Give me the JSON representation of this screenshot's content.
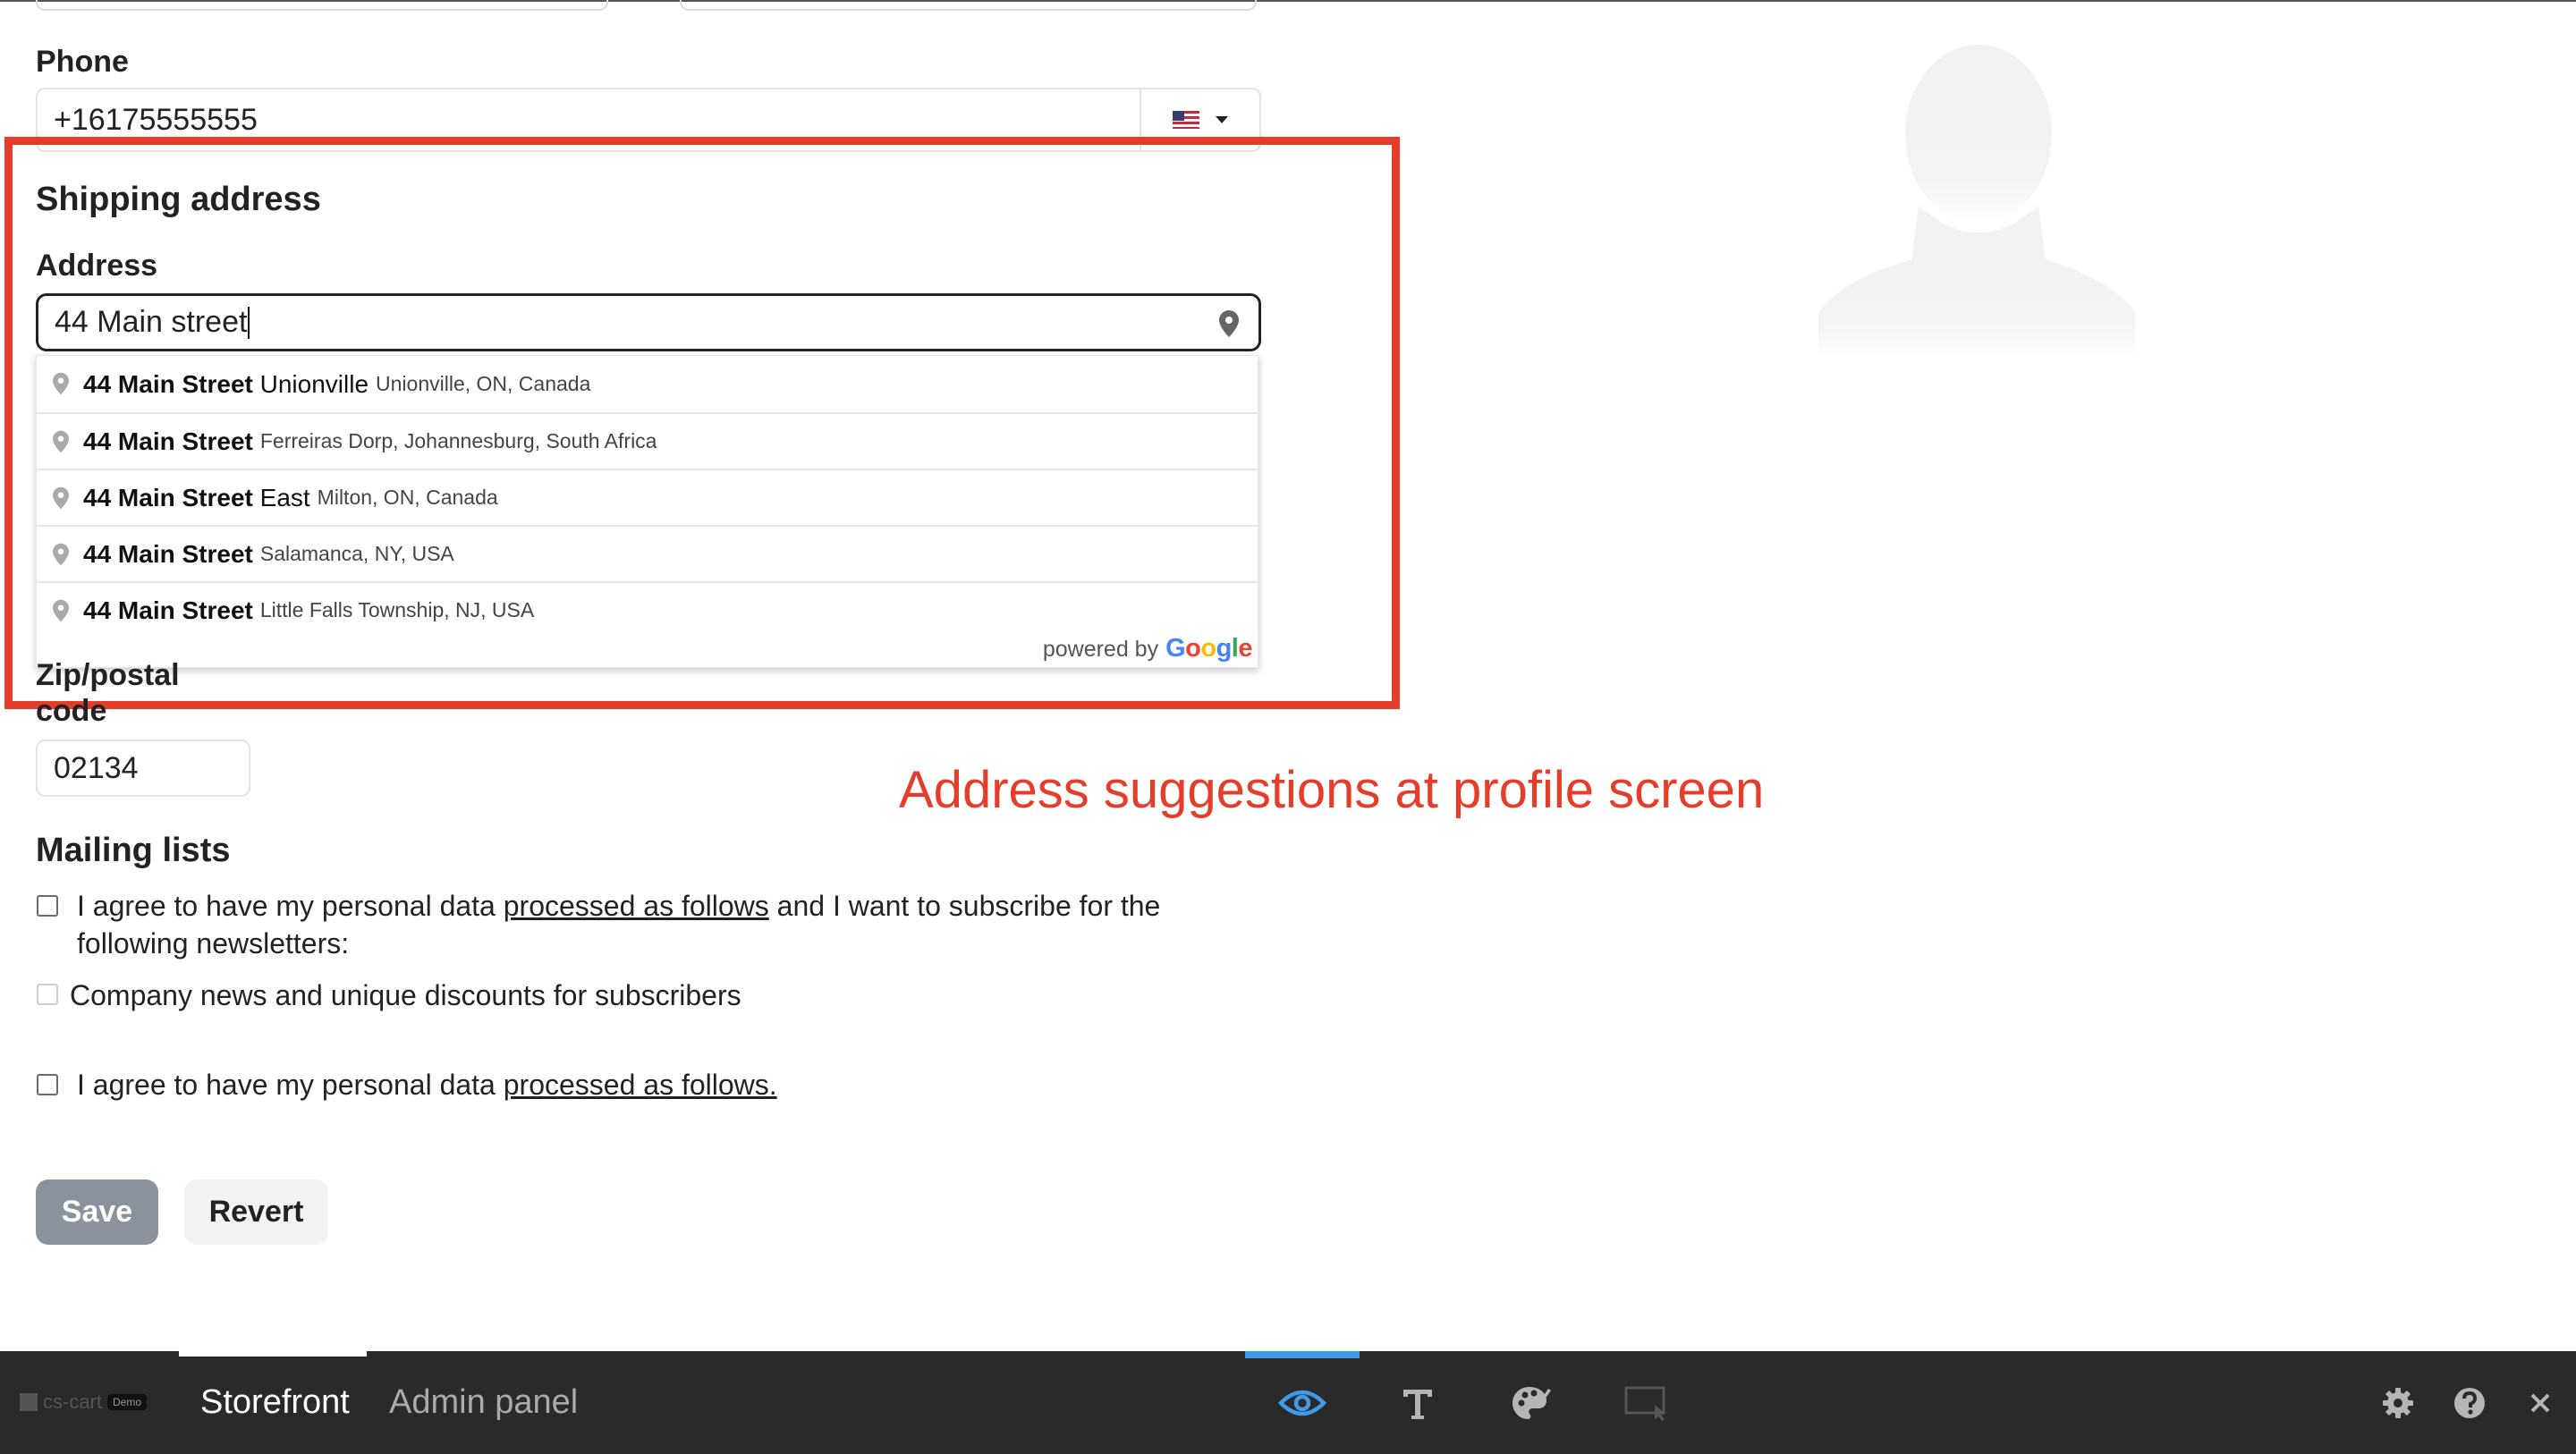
{
  "phone": {
    "label": "Phone",
    "value": "+16175555555"
  },
  "shipping": {
    "title": "Shipping address",
    "address_label": "Address",
    "address_value": "44 Main street",
    "suggestions": [
      {
        "main_bold": "44 Main Street",
        "main_rest": " Unionville",
        "secondary": "Unionville, ON, Canada"
      },
      {
        "main_bold": "44 Main Street",
        "main_rest": "",
        "secondary": "Ferreiras Dorp, Johannesburg, South Africa"
      },
      {
        "main_bold": "44 Main Street",
        "main_rest": " East",
        "secondary": "Milton, ON, Canada"
      },
      {
        "main_bold": "44 Main Street",
        "main_rest": "",
        "secondary": "Salamanca, NY, USA"
      },
      {
        "main_bold": "44 Main Street",
        "main_rest": "",
        "secondary": "Little Falls Township, NJ, USA"
      }
    ],
    "powered_by": "powered by",
    "google": "Google",
    "zip_label_line1": "Zip/postal",
    "zip_label_line2": "code",
    "zip_value": "02134"
  },
  "annotation": "Address suggestions at profile screen",
  "mailing": {
    "title": "Mailing lists",
    "consent1_pre": "I agree to have my personal data ",
    "consent1_link": "processed as follows",
    "consent1_post": " and I want to subscribe for the following newsletters:",
    "newsletter": "Company news and unique discounts for subscribers",
    "consent2_pre": "I agree to have my personal data ",
    "consent2_link": "processed as follows."
  },
  "buttons": {
    "save": "Save",
    "revert": "Revert"
  },
  "bottom_bar": {
    "logo_text": "cs-cart",
    "logo_badge": "Demo",
    "tabs": [
      "Storefront",
      "Admin panel"
    ],
    "active_tab": "Storefront",
    "icons": [
      "eye-icon",
      "text-icon",
      "palette-icon",
      "layout-icon",
      "gear-icon",
      "help-icon",
      "close-icon"
    ],
    "accent_color": "#3d9be9"
  },
  "colors": {
    "annotation_red": "#e63c2a",
    "save_button": "#8a939d",
    "bottom_bar": "#2a2a2a"
  }
}
